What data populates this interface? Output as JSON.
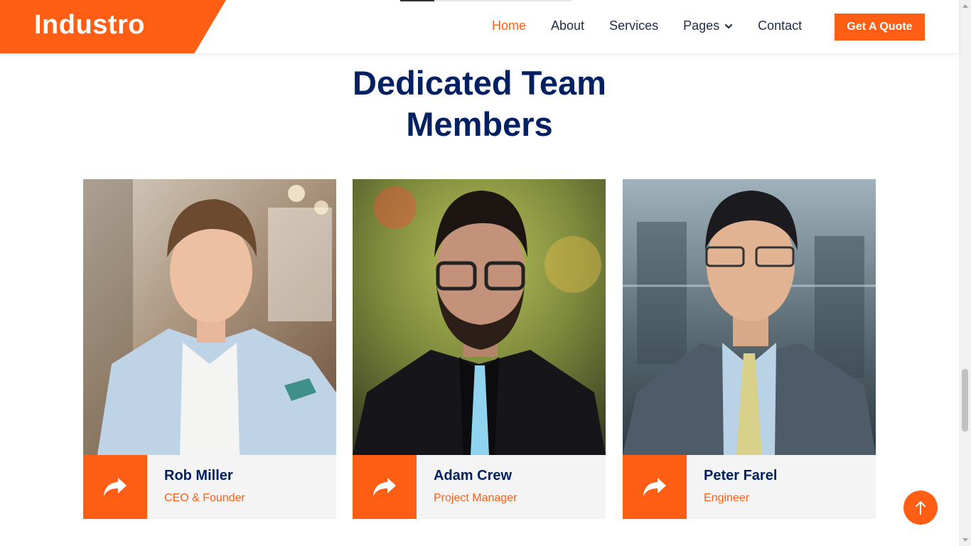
{
  "brand": {
    "name": "Industro",
    "color": "#ff5e14"
  },
  "nav": {
    "items": [
      {
        "label": "Home",
        "active": true
      },
      {
        "label": "About",
        "active": false
      },
      {
        "label": "Services",
        "active": false
      },
      {
        "label": "Pages",
        "active": false,
        "dropdown": true
      },
      {
        "label": "Contact",
        "active": false
      }
    ],
    "cta_label": "Get A Quote"
  },
  "section": {
    "title_line1": "Dedicated Team",
    "title_line2": "Members"
  },
  "team": [
    {
      "name": "Rob Miller",
      "role": "CEO & Founder",
      "share_icon": "share-icon"
    },
    {
      "name": "Adam Crew",
      "role": "Project Manager",
      "share_icon": "share-icon"
    },
    {
      "name": "Peter Farel",
      "role": "Engineer",
      "share_icon": "share-icon"
    }
  ],
  "colors": {
    "accent": "#ff5e14",
    "heading": "#022163",
    "card_bg": "#f4f4f4"
  },
  "icons": {
    "back_to_top": "arrow-up-icon",
    "dropdown": "chevron-down-icon"
  }
}
